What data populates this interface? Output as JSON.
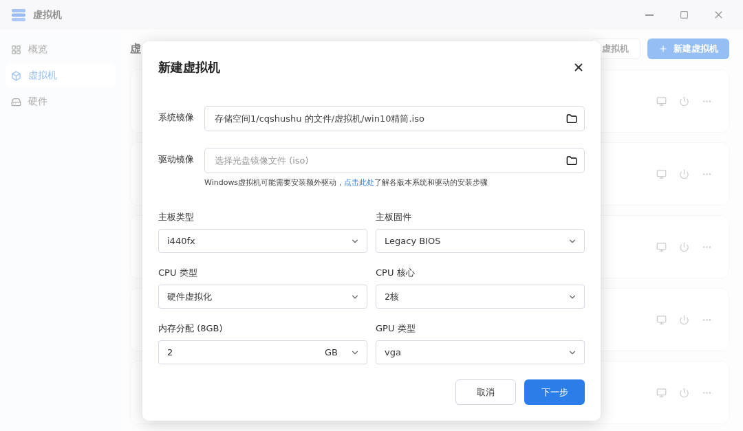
{
  "window": {
    "title": "虚拟机"
  },
  "sidebar": {
    "items": [
      {
        "label": "概览",
        "selected": false
      },
      {
        "label": "虚拟机",
        "selected": true
      },
      {
        "label": "硬件",
        "selected": false
      }
    ]
  },
  "main": {
    "heading": "虚",
    "buttons": [
      {
        "label": "虚拟机",
        "kind": "secondary"
      },
      {
        "label": "新建虚拟机",
        "kind": "primary"
      }
    ]
  },
  "dialog": {
    "title": "新建虚拟机",
    "file_fields": [
      {
        "label": "系统镜像",
        "value": "存储空间1/cqshushu 的文件/虚拟机/win10精简.iso"
      },
      {
        "label": "驱动镜像",
        "placeholder": "选择光盘镜像文件 (iso)"
      }
    ],
    "hint": {
      "before": "Windows虚拟机可能需要安装额外驱动，",
      "link": "点击此处",
      "after": "了解各版本系统和驱动的安装步骤"
    },
    "selects": [
      {
        "label": "主板类型",
        "value": "i440fx"
      },
      {
        "label": "主板固件",
        "value": "Legacy BIOS"
      },
      {
        "label": "CPU 类型",
        "value": "硬件虚拟化"
      },
      {
        "label": "CPU 核心",
        "value": "2核"
      },
      {
        "label": "内存分配 (8GB)",
        "value": "2",
        "unit": "GB"
      },
      {
        "label": "GPU 类型",
        "value": "vga"
      }
    ],
    "buttons": [
      {
        "label": "取消",
        "kind": "secondary"
      },
      {
        "label": "下一步",
        "kind": "primary"
      }
    ]
  }
}
